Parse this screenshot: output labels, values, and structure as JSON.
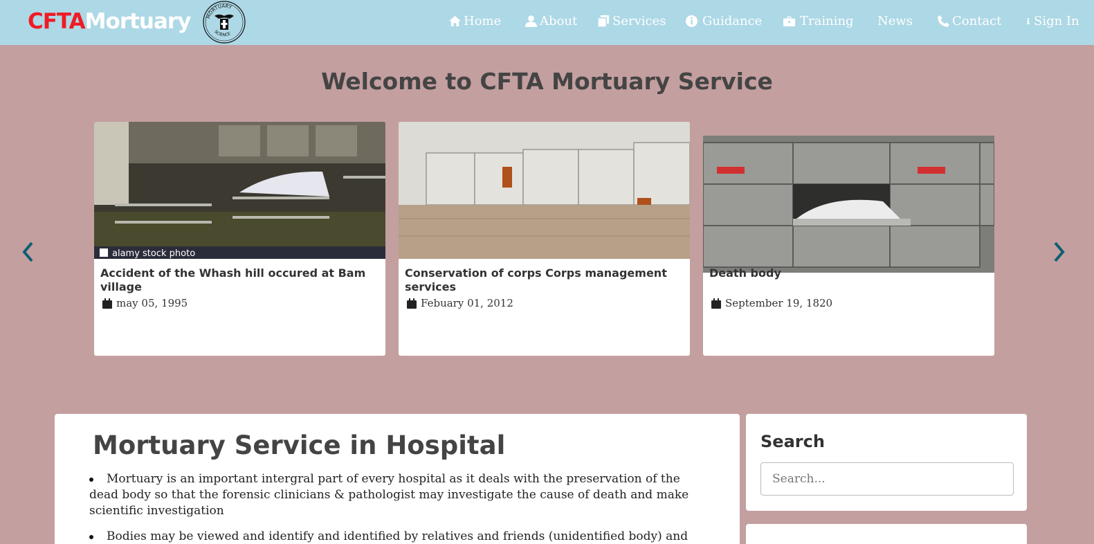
{
  "brand": {
    "part1": "CFTA",
    "part2": "Mortuary",
    "seal_top": "MORTUARY",
    "seal_bottom": "SCIENCE"
  },
  "nav": {
    "home": "Home",
    "about": "About",
    "services": "Services",
    "guidance": "Guidance",
    "training": "Training",
    "news": "News",
    "contact": "Contact",
    "signin": "Sign In"
  },
  "hero": {
    "heading": "Welcome to CFTA Mortuary Service"
  },
  "cards": [
    {
      "title": "Accident of the Whash hill occured at Bam village",
      "date": "may 05, 1995",
      "watermark": "alamy stock photo"
    },
    {
      "title": "Conservation of corps Corps management services",
      "date": "Febuary 01, 2012"
    },
    {
      "title": "Death body",
      "date": "September 19, 1820"
    }
  ],
  "main": {
    "title": "Mortuary Service in Hospital",
    "items": [
      "Mortuary is an important intergral part of every hospital as it deals with the preservation of the dead body so that the forensic clinicians & pathologist may investigate the cause of death and make scientific investigation",
      "Bodies may be viewed and identify and identified by relatives and friends (unidentified body) and bodies"
    ]
  },
  "sidebar": {
    "search_title": "Search",
    "search_placeholder": "Search..."
  },
  "colors": {
    "navbar": "#add8e6",
    "page_bg": "#c49fa0",
    "brand_red": "#ee1c25",
    "arrow": "#0d5d73"
  }
}
